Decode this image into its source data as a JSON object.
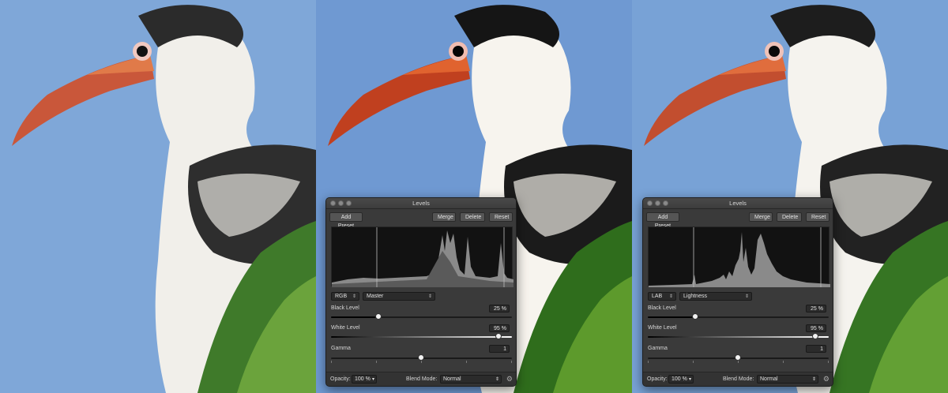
{
  "colors": {
    "sky": "#7aa3d6",
    "panel_bg": "#3a3a3a",
    "accent": "#e2e2e2"
  },
  "panels": [
    {
      "variant": "original"
    },
    {
      "variant": "rgb",
      "window_title": "Levels",
      "buttons": {
        "add_preset": "Add Preset",
        "merge": "Merge",
        "delete": "Delete",
        "reset": "Reset"
      },
      "color_space": "RGB",
      "channel": "Master",
      "black_level": {
        "label": "Black Level",
        "value": "25 %",
        "fraction": 0.25
      },
      "white_level": {
        "label": "White Level",
        "value": "95 %",
        "fraction": 0.95
      },
      "gamma": {
        "label": "Gamma",
        "value": "1",
        "fraction": 0.5
      },
      "opacity": {
        "label": "Opacity:",
        "value": "100 %"
      },
      "blend_mode": {
        "label": "Blend Mode:",
        "value": "Normal"
      }
    },
    {
      "variant": "lab",
      "window_title": "Levels",
      "buttons": {
        "add_preset": "Add Preset",
        "merge": "Merge",
        "delete": "Delete",
        "reset": "Reset"
      },
      "color_space": "LAB",
      "channel": "Lightness",
      "black_level": {
        "label": "Black Level",
        "value": "25 %",
        "fraction": 0.25
      },
      "white_level": {
        "label": "White Level",
        "value": "95 %",
        "fraction": 0.95
      },
      "gamma": {
        "label": "Gamma",
        "value": "1",
        "fraction": 0.5
      },
      "opacity": {
        "label": "Opacity:",
        "value": "100 %"
      },
      "blend_mode": {
        "label": "Blend Mode:",
        "value": "Normal"
      }
    }
  ]
}
